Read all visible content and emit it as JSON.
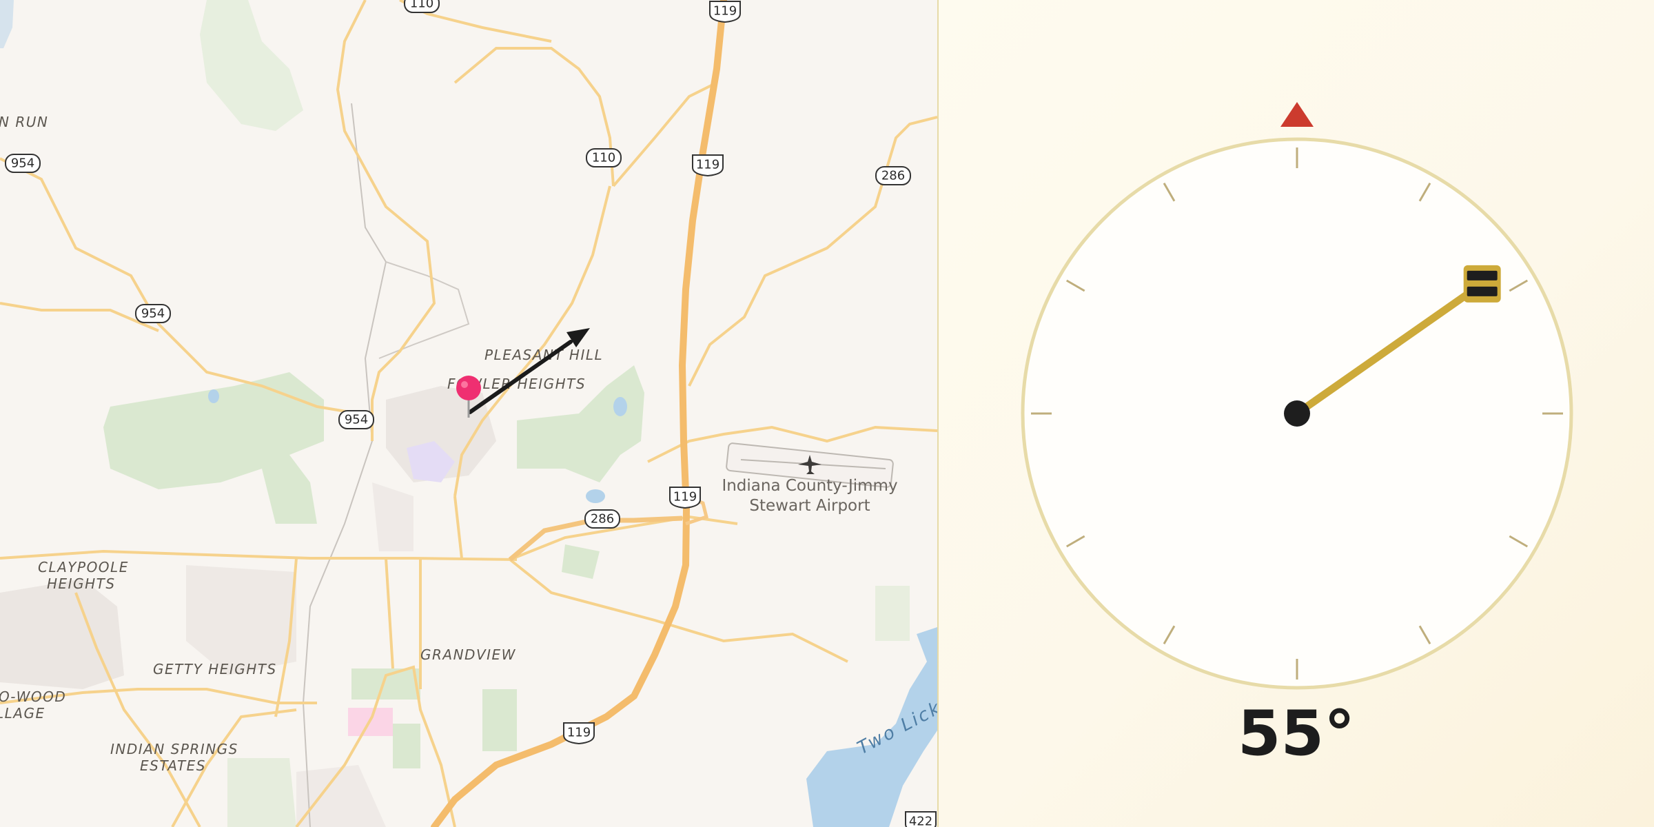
{
  "map": {
    "place_labels": [
      "N RUN",
      "PLEASANT HILL",
      "FOWLER HEIGHTS",
      "CLAYPOOLE",
      "HEIGHTS",
      "GRANDVIEW",
      "GETTY HEIGHTS",
      "O-WOOD",
      "LLAGE",
      "INDIAN SPRINGS",
      "ESTATES"
    ],
    "airport": {
      "name_line1": "Indiana County-Jimmy",
      "name_line2": "Stewart Airport"
    },
    "water_label": "Two Lick",
    "route_shields": [
      "110",
      "119",
      "110",
      "119",
      "954",
      "954",
      "954",
      "286",
      "119",
      "286",
      "119",
      "422"
    ],
    "marker": "location-pin-icon",
    "direction_arrow": "direction-arrow-icon"
  },
  "compass": {
    "heading_deg": 55,
    "heading_text": "55°",
    "north_marker_color": "#cc3b2e",
    "needle_color": "#cdaa3a",
    "dial_border_color": "#e7dba8"
  }
}
